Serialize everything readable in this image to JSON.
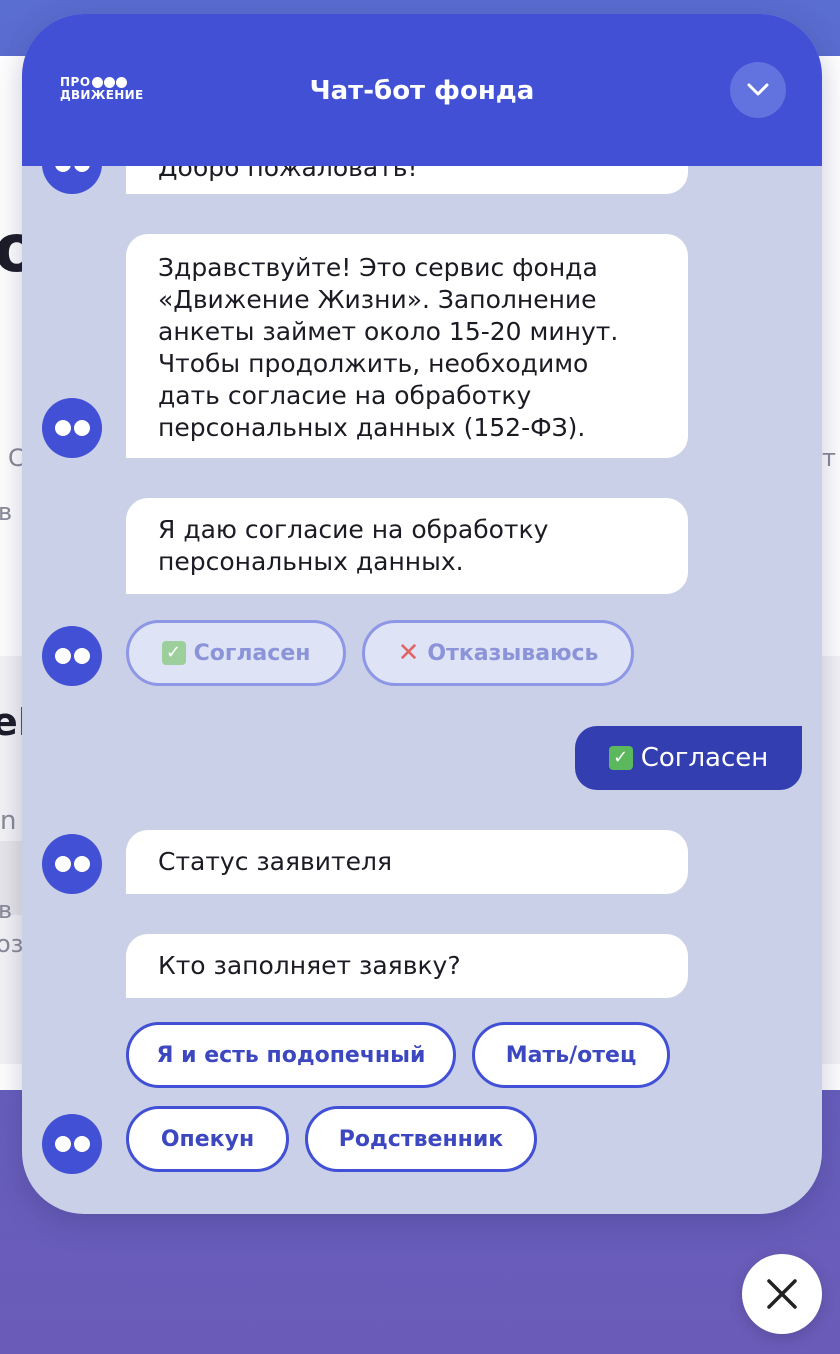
{
  "background": {
    "fragment_big": "о",
    "fragment_mid": "еМ",
    "fragment_s1": "С",
    "fragment_s2": "в I",
    "fragment_s3": "n",
    "fragment_s4": "в",
    "fragment_s5": "оз",
    "fragment_s6": "т"
  },
  "header": {
    "logo_top": "ПРО",
    "logo_bottom": "ДВИЖЕНИЕ",
    "title": "Чат-бот фонда"
  },
  "messages": {
    "welcome": "Добро пожаловать!",
    "intro": "Здравствуйте! Это сервис фонда «Движение Жизни». Заполнение анкеты займет около 15-20 минут. Чтобы продолжить, необходимо дать согласие на обработку персональных данных (152-ФЗ).",
    "consent": "Я даю согласие на обработку персональных данных.",
    "status": "Статус заявителя",
    "who": "Кто заполняет заявку?"
  },
  "consent_options": {
    "agree": "Согласен",
    "refuse": "Отказываюсь"
  },
  "user_reply": "Согласен",
  "who_options": {
    "self": "Я и есть подопечный",
    "parent": "Мать/отец",
    "guardian": "Опекун",
    "relative": "Родственник"
  },
  "colors": {
    "accent": "#4150d4",
    "chat_bg": "#c9d0e8",
    "user_bubble": "#333fb0"
  }
}
